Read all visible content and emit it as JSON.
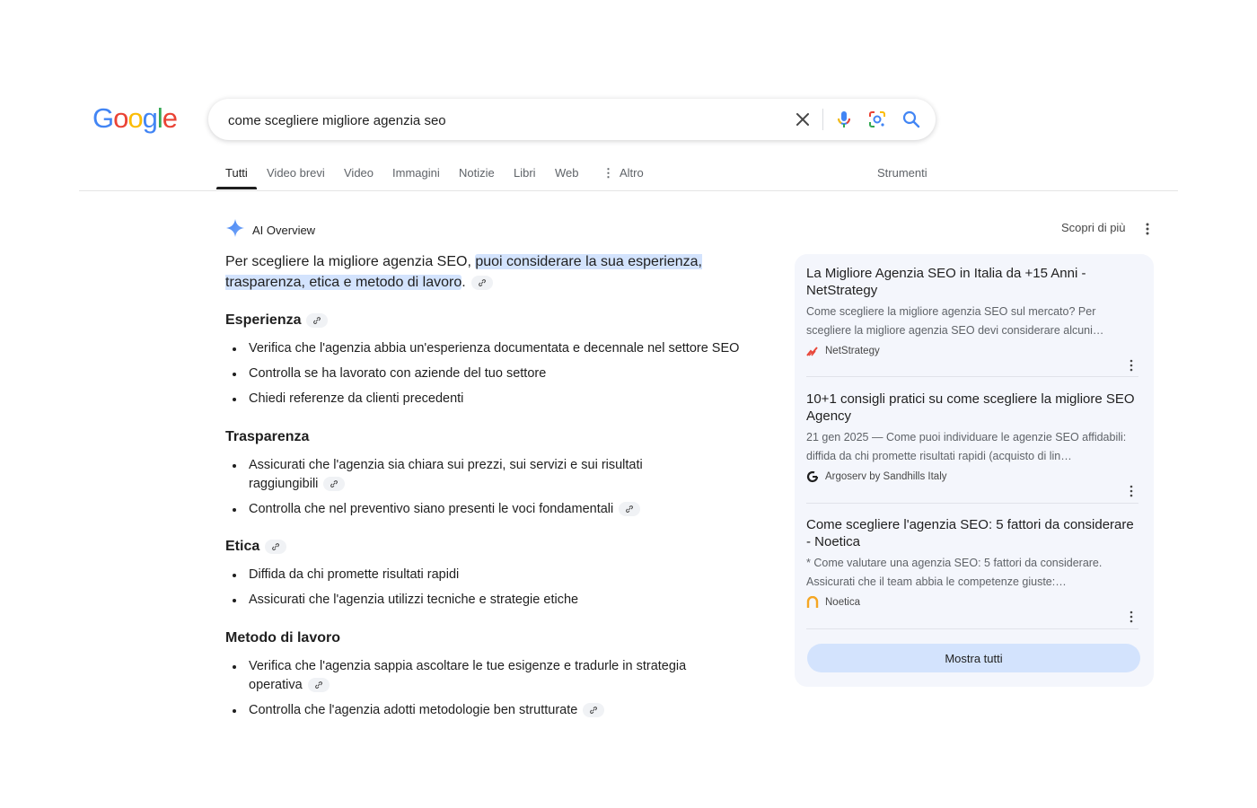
{
  "logo": {
    "letters": [
      "G",
      "o",
      "o",
      "g",
      "l",
      "e"
    ],
    "colors": [
      "#4285f4",
      "#ea4335",
      "#fbbc05",
      "#4285f4",
      "#34a853",
      "#ea4335"
    ]
  },
  "search": {
    "query": "come scegliere migliore agenzia seo",
    "icons": [
      "close-icon",
      "mic-icon",
      "lens-icon",
      "search-icon"
    ]
  },
  "tabs": [
    {
      "label": "Tutti",
      "active": true
    },
    {
      "label": "Video brevi"
    },
    {
      "label": "Video"
    },
    {
      "label": "Immagini"
    },
    {
      "label": "Notizie"
    },
    {
      "label": "Libri"
    },
    {
      "label": "Web"
    },
    {
      "label": "Altro"
    }
  ],
  "tools_label": "Strumenti",
  "ai_overview": {
    "title": "AI Overview",
    "more_label": "Scopri di più",
    "lead_plain": "Per scegliere la migliore agenzia SEO, ",
    "lead_highlight": "puoi considerare la sua esperienza, trasparenza, etica e metodo di lavoro",
    "lead_end": ".",
    "sections": [
      {
        "heading": "Esperienza",
        "items": [
          "Verifica che l'agenzia abbia un'esperienza documentata e decennale nel settore SEO",
          "Controlla se ha lavorato con aziende del tuo settore",
          "Chiedi referenze da clienti precedenti"
        ]
      },
      {
        "heading": "Trasparenza",
        "items": [
          "Assicurati che l'agenzia sia chiara sui prezzi, sui servizi e sui risultati raggiungibili",
          "Controlla che nel preventivo siano presenti le voci fondamentali"
        ]
      },
      {
        "heading": "Etica",
        "items": [
          "Diffida da chi promette risultati rapidi",
          "Assicurati che l'agenzia utilizzi tecniche e strategie etiche"
        ]
      },
      {
        "heading": "Metodo di lavoro",
        "items": [
          "Verifica che l'agenzia sappia ascoltare le tue esigenze e tradurle in strategia operativa",
          "Controlla che l'agenzia adotti metodologie ben strutturate"
        ]
      }
    ]
  },
  "sources": [
    {
      "title": "La Migliore Agenzia SEO in Italia da +15 Anni - NetStrategy",
      "snippet": "Come scegliere la migliore agenzia SEO sul mercato? Per scegliere la migliore agenzia SEO devi considerare alcuni…",
      "site": "NetStrategy",
      "icon_color": "#e8473a"
    },
    {
      "title": "10+1 consigli pratici su come scegliere la migliore SEO Agency",
      "snippet": "21 gen 2025 — Come puoi individuare le agenzie SEO affidabili: diffida da chi promette risultati rapidi (acquisto di lin…",
      "site": "Argoserv by Sandhills Italy",
      "icon_color": "#1f1f1f"
    },
    {
      "title": "Come scegliere l'agenzia SEO: 5 fattori da considerare - Noetica",
      "snippet": "* Come valutare una agenzia SEO: 5 fattori da considerare. Assicurati che il team abbia le competenze giuste:…",
      "site": "Noetica",
      "icon_color": "#f5a623"
    }
  ],
  "show_all_label": "Mostra tutti",
  "colors": {
    "highlight": "#d3e3fd",
    "panel": "#f4f6fc",
    "accent_blue": "#4285f4"
  }
}
